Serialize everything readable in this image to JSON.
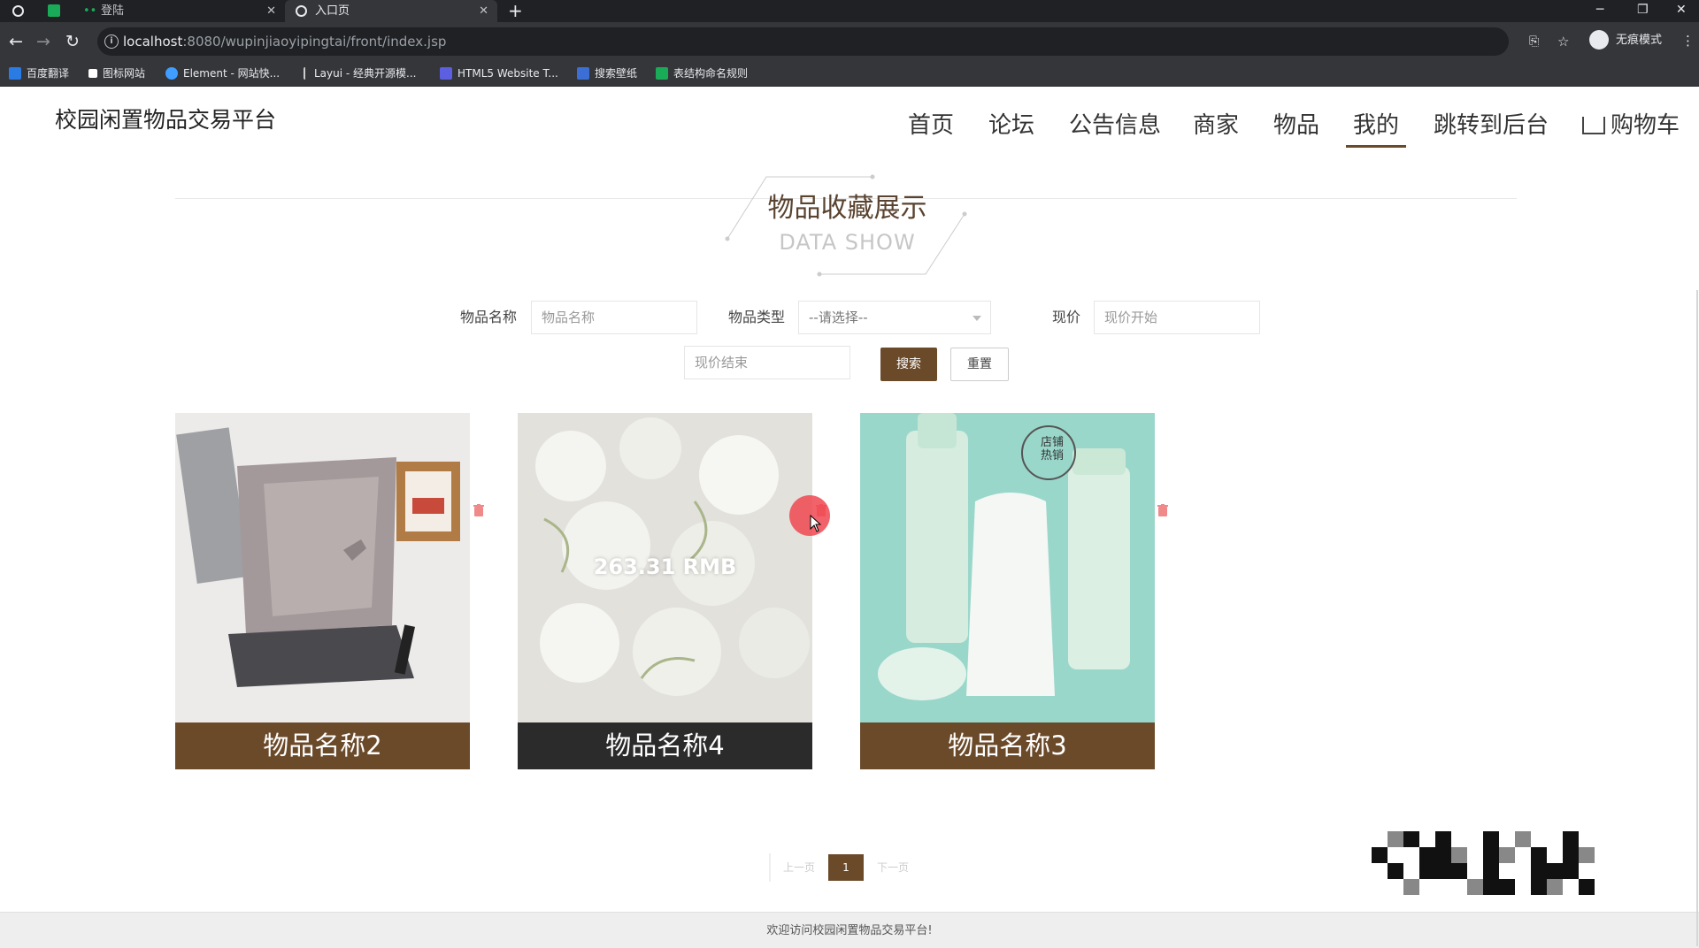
{
  "browser": {
    "tabs": [
      {
        "label": "登陆"
      },
      {
        "label": "入口页"
      }
    ],
    "url_host": "localhost",
    "url_rest": ":8080/wupinjiaoyipingtai/front/index.jsp",
    "profile_label": "无痕模式",
    "bookmarks": [
      {
        "label": "百度翻译",
        "color": "#2a7be4"
      },
      {
        "label": "图标网站",
        "color": "#ffffff"
      },
      {
        "label": "Element - 网站快...",
        "color": "#409eff"
      },
      {
        "label": "Layui - 经典开源模...",
        "color": "#cccccc"
      },
      {
        "label": "HTML5 Website T...",
        "color": "#5b5fe0"
      },
      {
        "label": "搜索壁纸",
        "color": "#3b6fd6"
      },
      {
        "label": "表结构命名规则",
        "color": "#1aab58"
      }
    ]
  },
  "site": {
    "brand": "校园闲置物品交易平台",
    "nav": [
      "首页",
      "论坛",
      "公告信息",
      "商家",
      "物品",
      "我的",
      "跳转到后台",
      "购物车"
    ],
    "active_nav": "我的",
    "accent_color": "#6b4a2a"
  },
  "section": {
    "title_cn": "物品收藏展示",
    "title_en": "DATA SHOW"
  },
  "search": {
    "name_label": "物品名称",
    "name_placeholder": "物品名称",
    "type_label": "物品类型",
    "type_selected": "--请选择--",
    "price_label": "现价",
    "price_start_placeholder": "现价开始",
    "price_end_placeholder": "现价结束",
    "search_button": "搜索",
    "reset_button": "重置"
  },
  "items": [
    {
      "name": "物品名称2",
      "image": "laptop-photo"
    },
    {
      "name": "物品名称4",
      "image": "white-flowers-photo",
      "price_overlay": "263.31 RMB"
    },
    {
      "name": "物品名称3",
      "image": "skincare-bottles-photo",
      "badge": "店铺热销"
    }
  ],
  "pagination": {
    "prev": "上一页",
    "current": "1",
    "next": "下一页"
  },
  "footer": {
    "text": "欢迎访问校园闲置物品交易平台!"
  }
}
